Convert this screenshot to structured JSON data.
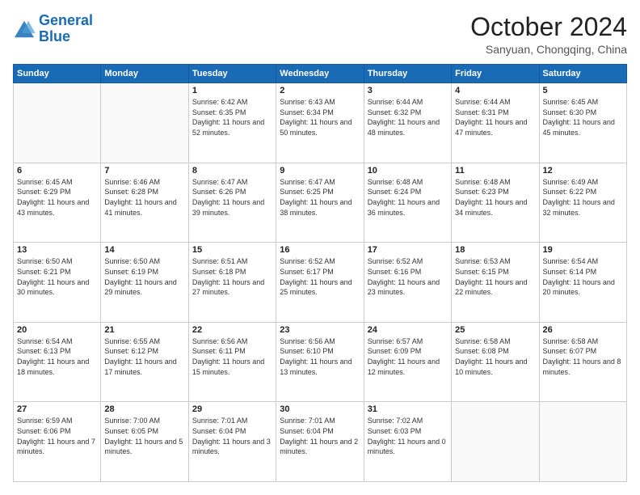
{
  "logo": {
    "line1": "General",
    "line2": "Blue"
  },
  "title": "October 2024",
  "subtitle": "Sanyuan, Chongqing, China",
  "days_header": [
    "Sunday",
    "Monday",
    "Tuesday",
    "Wednesday",
    "Thursday",
    "Friday",
    "Saturday"
  ],
  "weeks": [
    [
      {
        "day": "",
        "info": ""
      },
      {
        "day": "",
        "info": ""
      },
      {
        "day": "1",
        "info": "Sunrise: 6:42 AM\nSunset: 6:35 PM\nDaylight: 11 hours and 52 minutes."
      },
      {
        "day": "2",
        "info": "Sunrise: 6:43 AM\nSunset: 6:34 PM\nDaylight: 11 hours and 50 minutes."
      },
      {
        "day": "3",
        "info": "Sunrise: 6:44 AM\nSunset: 6:32 PM\nDaylight: 11 hours and 48 minutes."
      },
      {
        "day": "4",
        "info": "Sunrise: 6:44 AM\nSunset: 6:31 PM\nDaylight: 11 hours and 47 minutes."
      },
      {
        "day": "5",
        "info": "Sunrise: 6:45 AM\nSunset: 6:30 PM\nDaylight: 11 hours and 45 minutes."
      }
    ],
    [
      {
        "day": "6",
        "info": "Sunrise: 6:45 AM\nSunset: 6:29 PM\nDaylight: 11 hours and 43 minutes."
      },
      {
        "day": "7",
        "info": "Sunrise: 6:46 AM\nSunset: 6:28 PM\nDaylight: 11 hours and 41 minutes."
      },
      {
        "day": "8",
        "info": "Sunrise: 6:47 AM\nSunset: 6:26 PM\nDaylight: 11 hours and 39 minutes."
      },
      {
        "day": "9",
        "info": "Sunrise: 6:47 AM\nSunset: 6:25 PM\nDaylight: 11 hours and 38 minutes."
      },
      {
        "day": "10",
        "info": "Sunrise: 6:48 AM\nSunset: 6:24 PM\nDaylight: 11 hours and 36 minutes."
      },
      {
        "day": "11",
        "info": "Sunrise: 6:48 AM\nSunset: 6:23 PM\nDaylight: 11 hours and 34 minutes."
      },
      {
        "day": "12",
        "info": "Sunrise: 6:49 AM\nSunset: 6:22 PM\nDaylight: 11 hours and 32 minutes."
      }
    ],
    [
      {
        "day": "13",
        "info": "Sunrise: 6:50 AM\nSunset: 6:21 PM\nDaylight: 11 hours and 30 minutes."
      },
      {
        "day": "14",
        "info": "Sunrise: 6:50 AM\nSunset: 6:19 PM\nDaylight: 11 hours and 29 minutes."
      },
      {
        "day": "15",
        "info": "Sunrise: 6:51 AM\nSunset: 6:18 PM\nDaylight: 11 hours and 27 minutes."
      },
      {
        "day": "16",
        "info": "Sunrise: 6:52 AM\nSunset: 6:17 PM\nDaylight: 11 hours and 25 minutes."
      },
      {
        "day": "17",
        "info": "Sunrise: 6:52 AM\nSunset: 6:16 PM\nDaylight: 11 hours and 23 minutes."
      },
      {
        "day": "18",
        "info": "Sunrise: 6:53 AM\nSunset: 6:15 PM\nDaylight: 11 hours and 22 minutes."
      },
      {
        "day": "19",
        "info": "Sunrise: 6:54 AM\nSunset: 6:14 PM\nDaylight: 11 hours and 20 minutes."
      }
    ],
    [
      {
        "day": "20",
        "info": "Sunrise: 6:54 AM\nSunset: 6:13 PM\nDaylight: 11 hours and 18 minutes."
      },
      {
        "day": "21",
        "info": "Sunrise: 6:55 AM\nSunset: 6:12 PM\nDaylight: 11 hours and 17 minutes."
      },
      {
        "day": "22",
        "info": "Sunrise: 6:56 AM\nSunset: 6:11 PM\nDaylight: 11 hours and 15 minutes."
      },
      {
        "day": "23",
        "info": "Sunrise: 6:56 AM\nSunset: 6:10 PM\nDaylight: 11 hours and 13 minutes."
      },
      {
        "day": "24",
        "info": "Sunrise: 6:57 AM\nSunset: 6:09 PM\nDaylight: 11 hours and 12 minutes."
      },
      {
        "day": "25",
        "info": "Sunrise: 6:58 AM\nSunset: 6:08 PM\nDaylight: 11 hours and 10 minutes."
      },
      {
        "day": "26",
        "info": "Sunrise: 6:58 AM\nSunset: 6:07 PM\nDaylight: 11 hours and 8 minutes."
      }
    ],
    [
      {
        "day": "27",
        "info": "Sunrise: 6:59 AM\nSunset: 6:06 PM\nDaylight: 11 hours and 7 minutes."
      },
      {
        "day": "28",
        "info": "Sunrise: 7:00 AM\nSunset: 6:05 PM\nDaylight: 11 hours and 5 minutes."
      },
      {
        "day": "29",
        "info": "Sunrise: 7:01 AM\nSunset: 6:04 PM\nDaylight: 11 hours and 3 minutes."
      },
      {
        "day": "30",
        "info": "Sunrise: 7:01 AM\nSunset: 6:04 PM\nDaylight: 11 hours and 2 minutes."
      },
      {
        "day": "31",
        "info": "Sunrise: 7:02 AM\nSunset: 6:03 PM\nDaylight: 11 hours and 0 minutes."
      },
      {
        "day": "",
        "info": ""
      },
      {
        "day": "",
        "info": ""
      }
    ]
  ]
}
